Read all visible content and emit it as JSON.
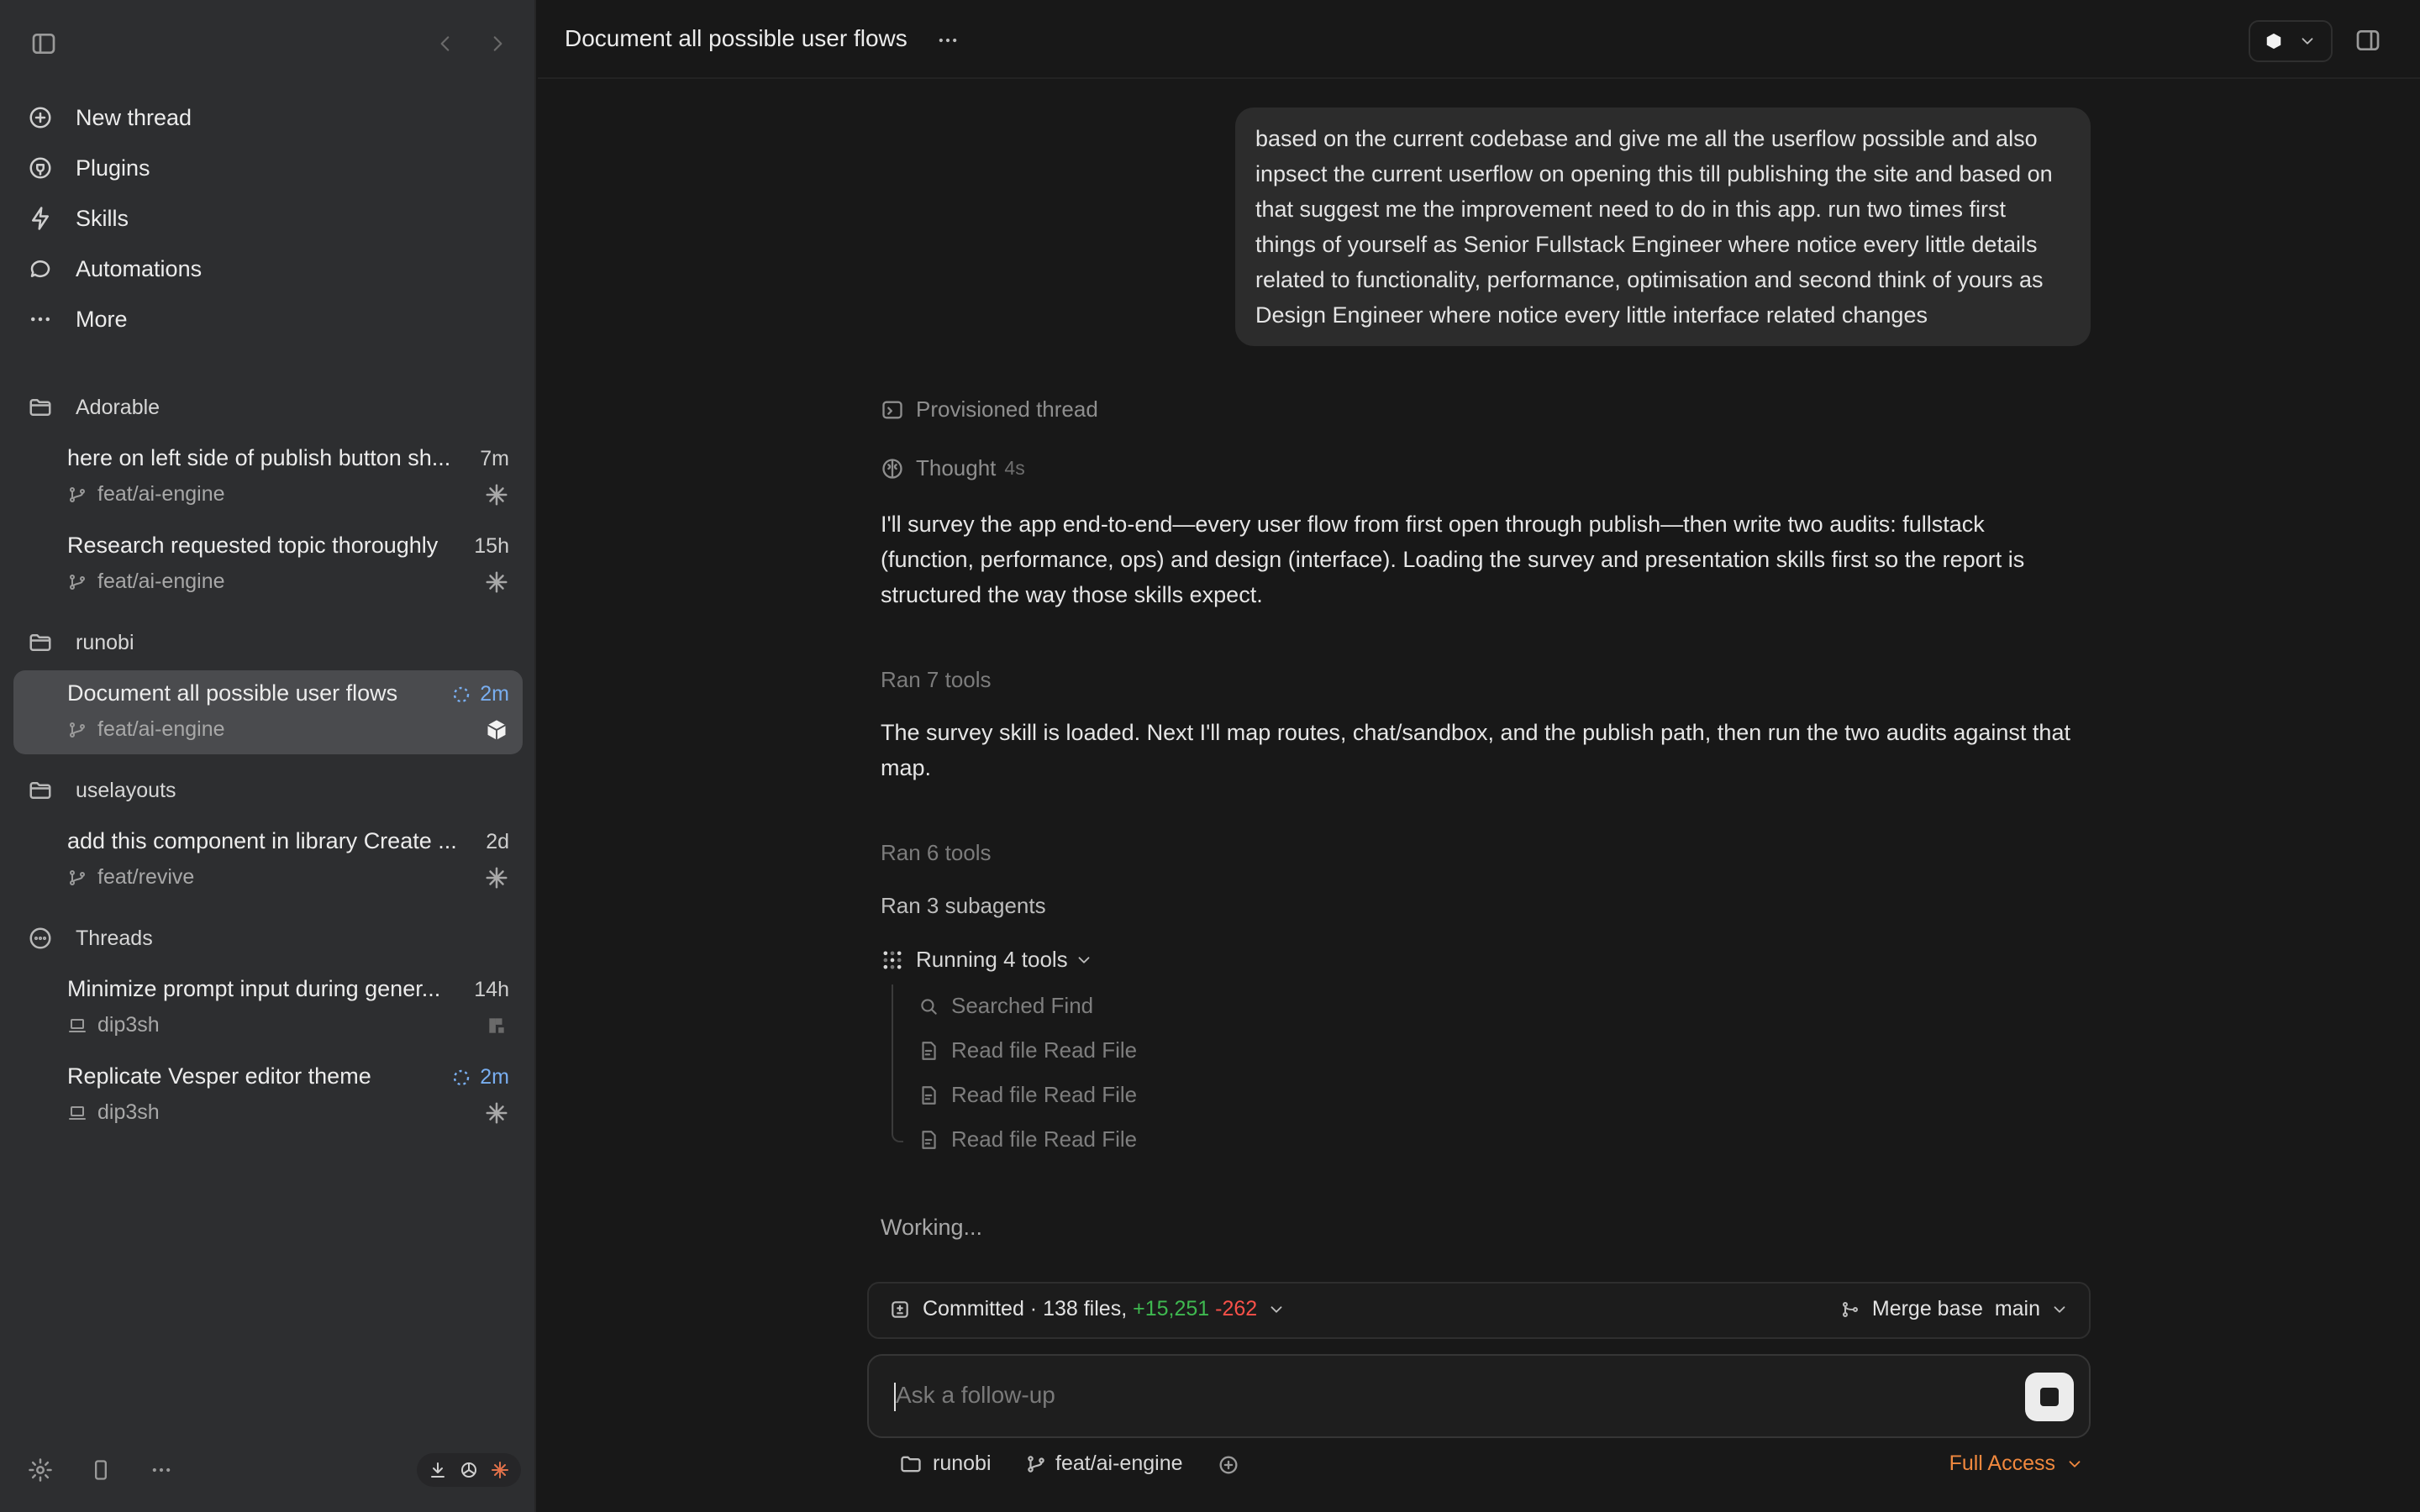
{
  "sidebar": {
    "nav": [
      {
        "label": "New thread",
        "icon": "plus-circle-icon"
      },
      {
        "label": "Plugins",
        "icon": "plugin-icon"
      },
      {
        "label": "Skills",
        "icon": "bolt-icon"
      },
      {
        "label": "Automations",
        "icon": "chat-bubble-icon"
      },
      {
        "label": "More",
        "icon": "ellipsis-icon"
      }
    ],
    "projects": [
      {
        "name": "Adorable",
        "threads": [
          {
            "title": "here on left side of publish button sh...",
            "time": "7m",
            "branch": "feat/ai-engine"
          },
          {
            "title": "Research requested topic thoroughly",
            "time": "15h",
            "branch": "feat/ai-engine"
          }
        ]
      },
      {
        "name": "runobi",
        "threads": [
          {
            "title": "Document all possible user flows",
            "time": "2m",
            "branch": "feat/ai-engine"
          }
        ]
      },
      {
        "name": "uselayouts",
        "threads": [
          {
            "title": "add this component in library Create ...",
            "time": "2d",
            "branch": "feat/revive"
          }
        ]
      },
      {
        "name": "Threads",
        "threads": [
          {
            "title": "Minimize prompt input during gener...",
            "time": "14h",
            "branch": "dip3sh"
          },
          {
            "title": "Replicate Vesper editor theme",
            "time": "2m",
            "branch": "dip3sh"
          }
        ]
      }
    ]
  },
  "header": {
    "title": "Document all possible user flows"
  },
  "conversation": {
    "user_message": "based on the current codebase and give me all the userflow possible and also inpsect the current userflow on opening this till publishing the site and based on that suggest me the improvement need to do in this app. run two times first things of yourself as Senior Fullstack Engineer where notice every little details related to functionality, performance, optimisation and second think of yours as Design Engineer where notice every little interface related changes",
    "provisioned": "Provisioned thread",
    "thought": "Thought",
    "thought_time": "4s",
    "para1": "I'll survey the app end-to-end—every user flow from first open through publish—then write two audits: fullstack (function, performance, ops) and design (interface). Loading the survey and presentation skills first so the report is structured the way those skills expect.",
    "ran_tools_1": "Ran 7 tools",
    "para2": "The survey skill is loaded. Next I'll map routes, chat/sandbox, and the publish path, then run the two audits against that map.",
    "ran_tools_2": "Ran 6 tools",
    "ran_subagents": "Ran 3 subagents",
    "running_tools": "Running 4 tools",
    "tool_calls": [
      {
        "action": "Searched",
        "target": "Find"
      },
      {
        "action": "Read file",
        "target": "Read File"
      },
      {
        "action": "Read file",
        "target": "Read File"
      },
      {
        "action": "Read file",
        "target": "Read File"
      }
    ],
    "working": "Working..."
  },
  "commit": {
    "label": "Committed · 138 files,",
    "additions": "+15,251",
    "deletions": "-262",
    "merge_label": "Merge base",
    "merge_branch": "main"
  },
  "composer": {
    "placeholder": "Ask a follow-up"
  },
  "footer": {
    "project": "runobi",
    "branch": "feat/ai-engine",
    "access": "Full Access"
  },
  "colors": {
    "additions": "#3fb950",
    "deletions": "#f85149",
    "full_access": "#f0883e",
    "running": "#79aef0"
  }
}
